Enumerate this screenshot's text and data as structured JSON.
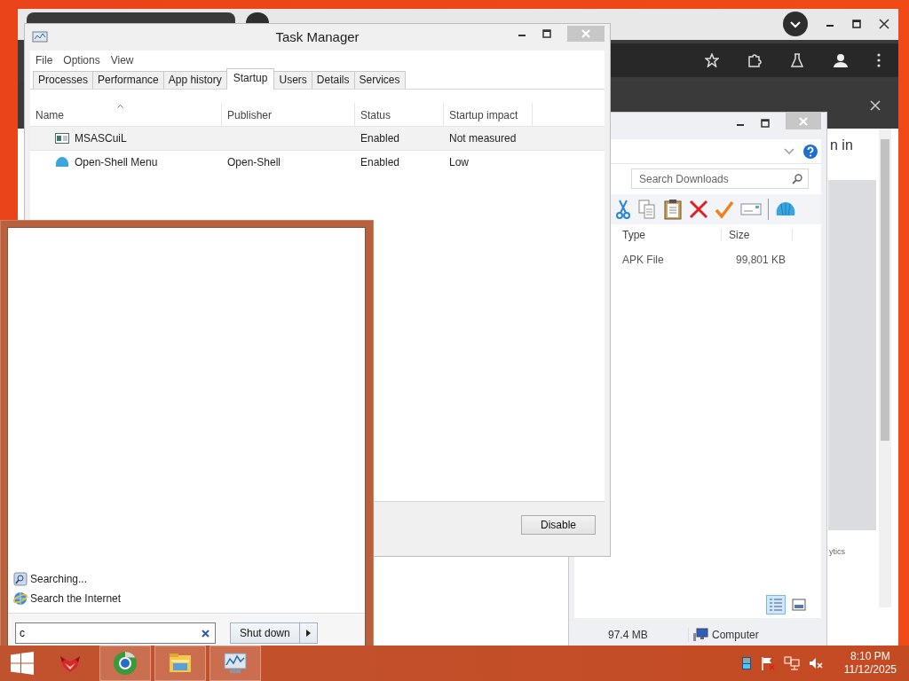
{
  "browser": {
    "visible_text": [
      "n in",
      "ytics"
    ]
  },
  "task_manager": {
    "title": "Task Manager",
    "menu": [
      "File",
      "Options",
      "View"
    ],
    "tabs": [
      {
        "label": "Processes",
        "selected": false
      },
      {
        "label": "Performance",
        "selected": false
      },
      {
        "label": "App history",
        "selected": false
      },
      {
        "label": "Startup",
        "selected": true
      },
      {
        "label": "Users",
        "selected": false
      },
      {
        "label": "Details",
        "selected": false
      },
      {
        "label": "Services",
        "selected": false
      }
    ],
    "columns": [
      "Name",
      "Publisher",
      "Status",
      "Startup impact"
    ],
    "rows": [
      {
        "kind": "window",
        "name": "MSASCuiL",
        "publisher": "",
        "status": "Enabled",
        "impact": "Not measured",
        "selected": true
      },
      {
        "kind": "shell",
        "name": "Open-Shell Menu",
        "publisher": "Open-Shell",
        "status": "Enabled",
        "impact": "Low",
        "selected": false
      }
    ],
    "button": "Disable"
  },
  "explorer": {
    "search": {
      "placeholder": "Search Downloads"
    },
    "columns": [
      "Type",
      "Size"
    ],
    "rows": [
      {
        "type": "APK File",
        "size": "99,801 KB"
      }
    ],
    "views": [
      {
        "kind": "details",
        "selected": true
      },
      {
        "kind": "preview",
        "selected": false
      }
    ],
    "status_bar": {
      "size": "97.4 MB",
      "location": "Computer"
    }
  },
  "start_menu": {
    "results": [
      {
        "kind": "search",
        "label": "Searching..."
      },
      {
        "kind": "internet",
        "label": "Search the Internet"
      }
    ],
    "search_field": {
      "value": "c"
    },
    "shutdown": "Shut down"
  },
  "taskbar": {
    "apps": [
      {
        "kind": "fox",
        "running": false
      },
      {
        "kind": "browser",
        "running": true
      },
      {
        "kind": "folder",
        "running": true
      },
      {
        "kind": "monitor",
        "running": true
      }
    ],
    "clock": {
      "time": "8:10 PM",
      "date": "11/12/2025"
    }
  }
}
